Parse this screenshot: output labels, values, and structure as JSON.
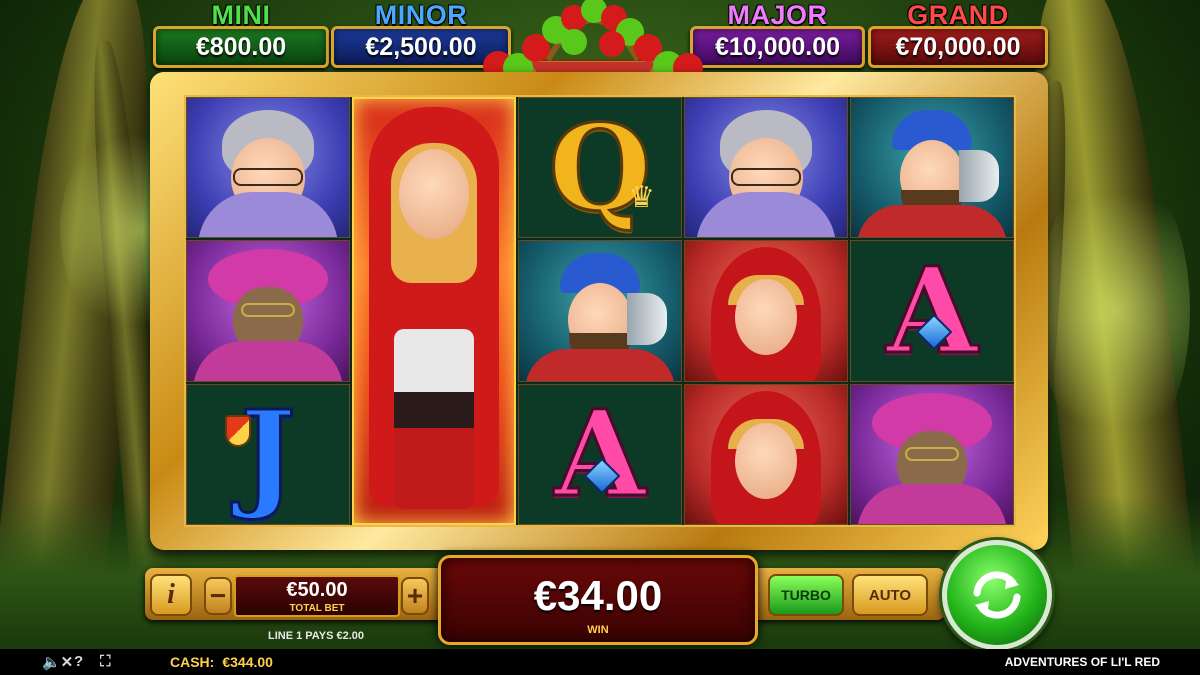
{
  "jackpots": {
    "mini": {
      "label": "MINI",
      "amount": "€800.00"
    },
    "minor": {
      "label": "MINOR",
      "amount": "€2,500.00"
    },
    "major": {
      "label": "MAJOR",
      "amount": "€10,000.00"
    },
    "grand": {
      "label": "GRAND",
      "amount": "€70,000.00"
    }
  },
  "reels": {
    "symbols": [
      [
        "granny",
        "wolf",
        "J"
      ],
      [
        "red-riding-hood-expanded",
        "red-riding-hood-expanded",
        "red-riding-hood-expanded"
      ],
      [
        "Q",
        "woodcutter",
        "A"
      ],
      [
        "granny",
        "red-riding-hood",
        "red-riding-hood"
      ],
      [
        "woodcutter",
        "A",
        "wolf"
      ]
    ],
    "letters": {
      "q": "Q",
      "a": "A",
      "j": "J"
    }
  },
  "controls": {
    "info_label": "i",
    "minus_label": "−",
    "plus_label": "+",
    "total_bet_value": "€50.00",
    "total_bet_label": "TOTAL BET",
    "win_value": "€34.00",
    "win_label": "WIN",
    "turbo_label": "TURBO",
    "auto_label": "AUTO",
    "line_pays": "LINE 1 PAYS €2.00"
  },
  "status_bar": {
    "sound_icon": "🔈✕",
    "help_icon": "?",
    "fullscreen_icon": "⛶",
    "cash_label": "CASH:",
    "cash_value": "€344.00",
    "game_title": "ADVENTURES OF LI'L RED"
  },
  "colors": {
    "frame_gold": "#d9a52a",
    "mini": "#4fe04a",
    "minor": "#4aa9ff",
    "major": "#f07bff",
    "grand": "#ff4a4a",
    "spin": "#22b41a"
  }
}
